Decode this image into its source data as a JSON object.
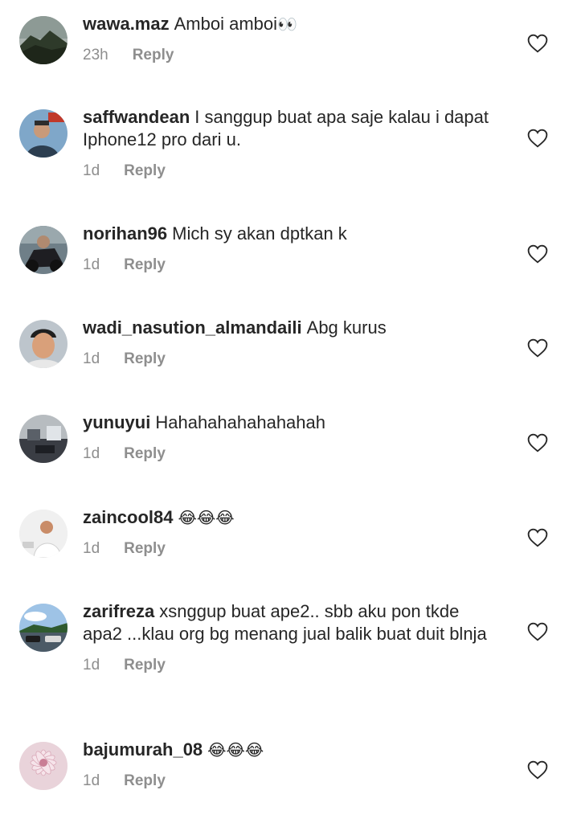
{
  "comments": [
    {
      "username": "wawa.maz",
      "text": "Amboi amboi",
      "emoji": "👀",
      "time": "23h",
      "reply": "Reply",
      "avatar_icon": "mountain-landscape-avatar",
      "avatar_colors": [
        "#8d9a95",
        "#3f4a38"
      ]
    },
    {
      "username": "saffwandean",
      "text": "I sanggup buat apa saje kalau i dapat Iphone12 pro dari u.",
      "emoji": "",
      "time": "1d",
      "reply": "Reply",
      "avatar_icon": "person-selfie-avatar",
      "avatar_colors": [
        "#7fa7c9",
        "#2c3e50"
      ]
    },
    {
      "username": "norihan96",
      "text": "Mich sy akan dptkan k",
      "emoji": "",
      "time": "1d",
      "reply": "Reply",
      "avatar_icon": "motorcycle-rider-avatar",
      "avatar_colors": [
        "#6f7f88",
        "#1e1e22"
      ]
    },
    {
      "username": "wadi_nasution_almandaili",
      "text": "Abg kurus",
      "emoji": "",
      "time": "1d",
      "reply": "Reply",
      "avatar_icon": "person-face-avatar",
      "avatar_colors": [
        "#bdc5cc",
        "#d9a07a"
      ]
    },
    {
      "username": "yunuyui",
      "text": "Hahahahahahahahah",
      "emoji": "",
      "time": "1d",
      "reply": "Reply",
      "avatar_icon": "interior-room-avatar",
      "avatar_colors": [
        "#b7bcc0",
        "#3a3d44"
      ]
    },
    {
      "username": "zaincool84",
      "text": "",
      "emoji": "😂😂😂",
      "time": "1d",
      "reply": "Reply",
      "avatar_icon": "person-white-shirt-avatar",
      "avatar_colors": [
        "#f0f0f0",
        "#c98c68"
      ]
    },
    {
      "username": "zarifreza",
      "text": "xsnggup buat ape2.. sbb aku pon tkde apa2 ...klau org bg  menang jual balik buat duit blnja",
      "emoji": "",
      "time": "1d",
      "reply": "Reply",
      "avatar_icon": "cars-parking-avatar",
      "avatar_colors": [
        "#9ec3e6",
        "#4b5a66"
      ]
    },
    {
      "username": "bajumurah_08",
      "text": "",
      "emoji": "😂😂😂",
      "time": "1d",
      "reply": "Reply",
      "avatar_icon": "pink-flower-avatar",
      "avatar_colors": [
        "#e9d3da",
        "#c97e95"
      ]
    }
  ],
  "like_icon": "heart-outline-icon",
  "colors": {
    "text": "#262626",
    "muted": "#8e8e8e",
    "background": "#ffffff"
  }
}
